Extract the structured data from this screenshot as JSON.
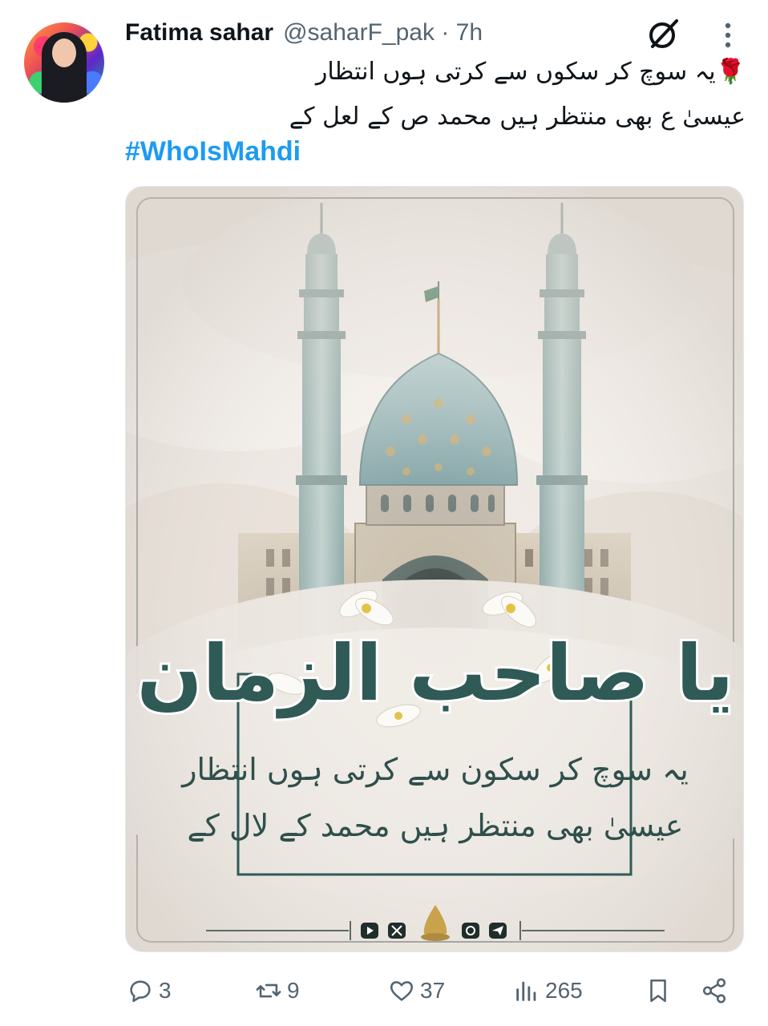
{
  "author": {
    "display_name": "Fatima sahar",
    "handle": "@saharF_pak",
    "separator": "·",
    "time": "7h"
  },
  "tweet": {
    "line1": "یہ سوچ کر سکوں سے کرتی ہوں انتظار",
    "line1_emoji": "🌹",
    "line2": "عیسیٰ ع بھی منتظر ہیں محمد ص کے لعل کے",
    "hashtag": "#WhoIsMahdi"
  },
  "media": {
    "calligraphy": "یا صاحب الزمان",
    "poem_line1": "یہ سوچ کر سکون سے کرتی ہوں انتظار",
    "poem_line2": "عیسیٰ بھی منتظر ہیں محمد کے لال کے"
  },
  "actions": {
    "replies": "3",
    "reposts": "9",
    "likes": "37",
    "views": "265"
  },
  "colors": {
    "link": "#1d9bf0",
    "muted": "#536471",
    "calligraphy": "#2f5a55"
  }
}
